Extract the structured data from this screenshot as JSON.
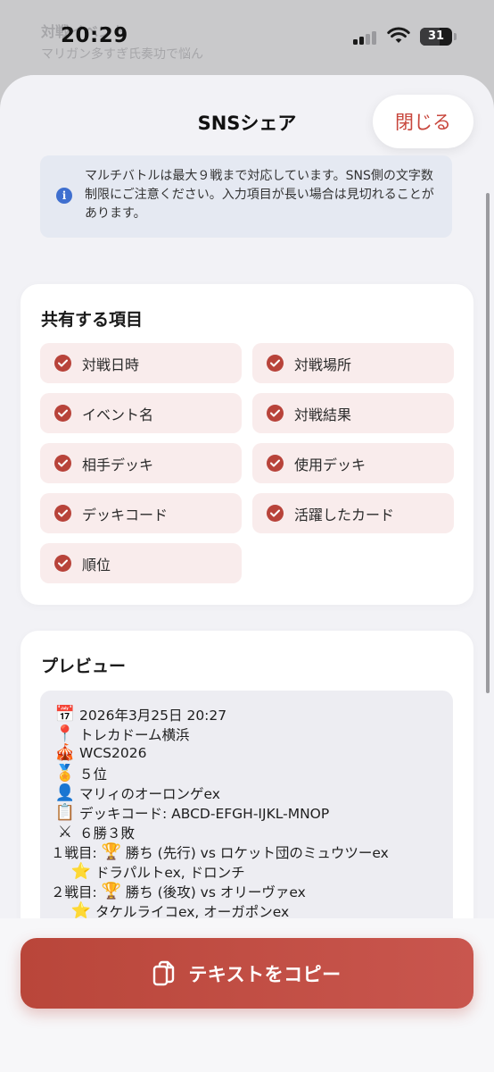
{
  "status": {
    "time": "20:29",
    "battery": "31"
  },
  "backdrop": {
    "title": "対戦イベント",
    "subtitle": "マリガン多すぎ氏奏功で悩ん"
  },
  "sheet": {
    "title": "SNSシェア",
    "close_label": "閉じる"
  },
  "notice": {
    "icon": "info-icon",
    "text": "マルチバトルは最大９戦まで対応しています。SNS側の文字数制限にご注意ください。入力項目が長い場合は見切れることがあります。"
  },
  "share": {
    "heading": "共有する項目",
    "items": [
      {
        "label": "対戦日時",
        "checked": true
      },
      {
        "label": "対戦場所",
        "checked": true
      },
      {
        "label": "イベント名",
        "checked": true
      },
      {
        "label": "対戦結果",
        "checked": true
      },
      {
        "label": "相手デッキ",
        "checked": true
      },
      {
        "label": "使用デッキ",
        "checked": true
      },
      {
        "label": "デッキコード",
        "checked": true
      },
      {
        "label": "活躍したカード",
        "checked": true
      },
      {
        "label": "順位",
        "checked": true
      }
    ],
    "accent": "#b8433a"
  },
  "preview": {
    "heading": "プレビュー",
    "lines": [
      {
        "icon": "calendar-icon",
        "glyph": "📅",
        "text": "2026年3月25日 20:27"
      },
      {
        "icon": "pin-icon",
        "glyph": "📍",
        "text": "トレカドーム横浜"
      },
      {
        "icon": "circus-tent-icon",
        "glyph": "🎪",
        "text": "WCS2026"
      },
      {
        "icon": "medal-icon",
        "glyph": "🏅",
        "text": "５位"
      },
      {
        "icon": "person-icon",
        "glyph": "👤",
        "text": "マリィのオーロンゲex"
      },
      {
        "icon": "clipboard-icon",
        "glyph": "📋",
        "text": "デッキコード: ABCD-EFGH-IJKL-MNOP"
      },
      {
        "icon": "crossed-swords-icon",
        "glyph": "⚔",
        "text": "６勝３敗"
      },
      {
        "icon": "trophy-icon",
        "glyph": "🏆",
        "prefix": "１戦目:",
        "text": "勝ち (先行) vs ロケット団のミュウツーex"
      },
      {
        "icon": "star-icon",
        "glyph": "⭐",
        "text": "ドラパルトex, ドロンチ"
      },
      {
        "icon": "trophy-icon",
        "glyph": "🏆",
        "prefix": "２戦目:",
        "text": "勝ち (後攻) vs オリーヴァex"
      },
      {
        "icon": "star-icon",
        "glyph": "⭐",
        "text": "タケルライコex, オーガポンex"
      }
    ]
  },
  "footer": {
    "copy_label": "テキストをコピー",
    "copy_icon": "copy-icon"
  },
  "colors": {
    "accent": "#c8463c",
    "button_gradient_start": "#b9463a",
    "button_gradient_end": "#c9564e",
    "chip_bg": "#f9ecec",
    "notice_bg": "#e5e9f2",
    "info_blue": "#3f6fcf"
  }
}
